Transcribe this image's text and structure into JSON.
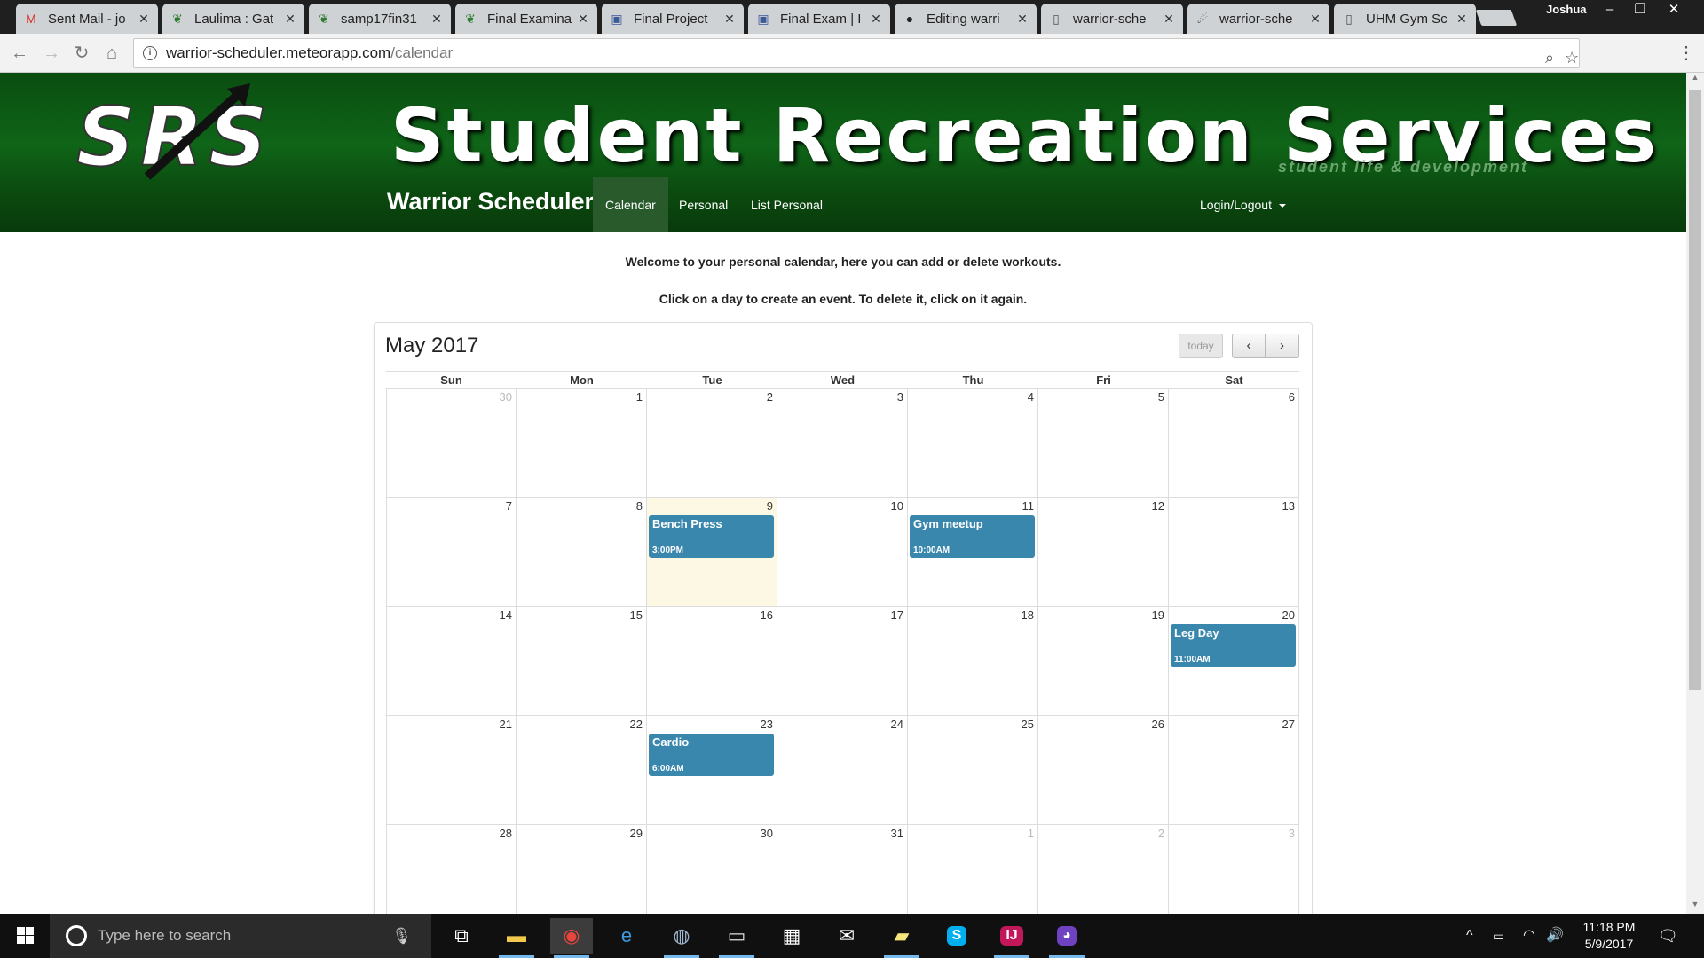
{
  "browser": {
    "tabs": [
      {
        "title": "Sent Mail - jo",
        "icon": "gmail-icon"
      },
      {
        "title": "Laulima : Gat",
        "icon": "laulima-icon"
      },
      {
        "title": "samp17fin31",
        "icon": "laulima-icon"
      },
      {
        "title": "Final Examina",
        "icon": "laulima-icon"
      },
      {
        "title": "Final Project",
        "icon": "page-icon"
      },
      {
        "title": "Final Exam | I",
        "icon": "page-icon"
      },
      {
        "title": "Editing warri",
        "icon": "github-icon"
      },
      {
        "title": "warrior-sche",
        "icon": "document-icon"
      },
      {
        "title": "warrior-sche",
        "icon": "meteor-icon"
      },
      {
        "title": "UHM Gym Sc",
        "icon": "document-icon"
      }
    ],
    "profile": "Joshua",
    "url_host": "warrior-scheduler.meteorapp.com",
    "url_path": "/calendar"
  },
  "banner": {
    "logo_text": "SRS",
    "title": "Student Recreation Services",
    "subtitle": "student life & development"
  },
  "navbar": {
    "brand": "Warrior Scheduler",
    "links": [
      "Calendar",
      "Personal",
      "List Personal"
    ],
    "active": "Calendar",
    "login": "Login/Logout"
  },
  "intro": {
    "line1": "Welcome to your personal calendar, here you can add or delete workouts.",
    "line2": "Click on a day to create an event. To delete it, click on it again."
  },
  "calendar": {
    "title": "May 2017",
    "today_label": "today",
    "prev_label": "‹",
    "next_label": "›",
    "weekdays": [
      "Sun",
      "Mon",
      "Tue",
      "Wed",
      "Thu",
      "Fri",
      "Sat"
    ],
    "weeks": [
      [
        {
          "d": "30",
          "other": true
        },
        {
          "d": "1"
        },
        {
          "d": "2"
        },
        {
          "d": "3"
        },
        {
          "d": "4"
        },
        {
          "d": "5"
        },
        {
          "d": "6"
        }
      ],
      [
        {
          "d": "7"
        },
        {
          "d": "8"
        },
        {
          "d": "9",
          "today": true,
          "event": {
            "title": "Bench Press",
            "time": "3:00PM"
          }
        },
        {
          "d": "10"
        },
        {
          "d": "11",
          "event": {
            "title": "Gym meetup",
            "time": "10:00AM"
          }
        },
        {
          "d": "12"
        },
        {
          "d": "13"
        }
      ],
      [
        {
          "d": "14"
        },
        {
          "d": "15"
        },
        {
          "d": "16"
        },
        {
          "d": "17"
        },
        {
          "d": "18"
        },
        {
          "d": "19"
        },
        {
          "d": "20",
          "event": {
            "title": "Leg Day",
            "time": "11:00AM"
          }
        }
      ],
      [
        {
          "d": "21"
        },
        {
          "d": "22"
        },
        {
          "d": "23",
          "event": {
            "title": "Cardio",
            "time": "6:00AM"
          }
        },
        {
          "d": "24"
        },
        {
          "d": "25"
        },
        {
          "d": "26"
        },
        {
          "d": "27"
        }
      ],
      [
        {
          "d": "28"
        },
        {
          "d": "29"
        },
        {
          "d": "30"
        },
        {
          "d": "31"
        },
        {
          "d": "1",
          "other": true
        },
        {
          "d": "2",
          "other": true
        },
        {
          "d": "3",
          "other": true
        }
      ]
    ]
  },
  "taskbar": {
    "search_placeholder": "Type here to search",
    "apps": [
      "task-view-icon",
      "file-explorer-icon",
      "chrome-icon",
      "edge-icon",
      "steam-icon",
      "terminal-icon",
      "store-icon",
      "mail-icon",
      "sticky-notes-icon",
      "skype-icon",
      "intellij-icon",
      "github-desktop-icon"
    ],
    "time": "11:18 PM",
    "date": "5/9/2017"
  },
  "colors": {
    "banner_green": "#0f6518",
    "nav_active": "#285a2c",
    "event_blue": "#3a87ad",
    "today_bg": "#fcf8e3"
  }
}
